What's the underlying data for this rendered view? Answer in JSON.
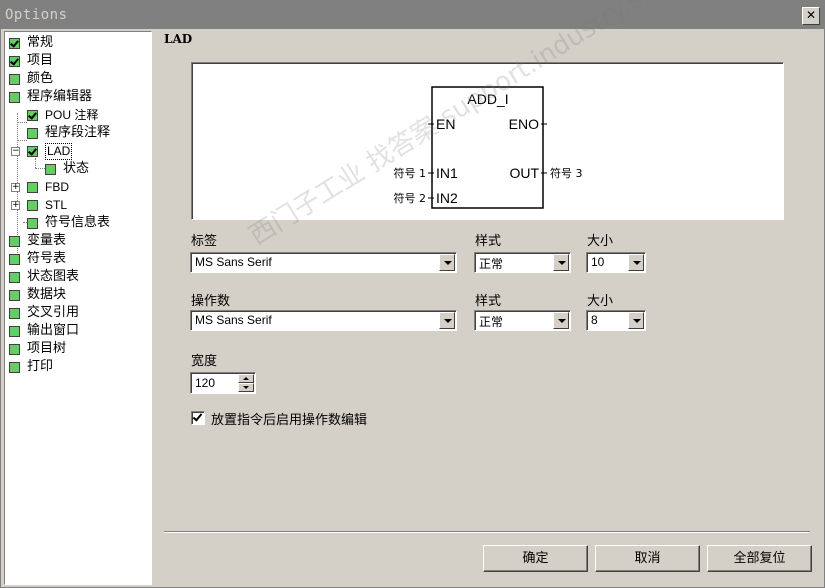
{
  "window": {
    "title": "Options",
    "close_glyph": "✕"
  },
  "tree": [
    {
      "label": "常规",
      "checked": true
    },
    {
      "label": "项目",
      "checked": true
    },
    {
      "label": "颜色",
      "checked": false
    },
    {
      "label": "程序编辑器",
      "checked": false
    },
    {
      "label": "POU 注释",
      "checked": true
    },
    {
      "label": "程序段注释",
      "checked": false
    },
    {
      "label": "LAD",
      "checked": true,
      "expander": "−"
    },
    {
      "label": "状态",
      "checked": false
    },
    {
      "label": "FBD",
      "checked": false,
      "expander": "+"
    },
    {
      "label": "STL",
      "checked": false,
      "expander": "+"
    },
    {
      "label": "符号信息表",
      "checked": false
    },
    {
      "label": "变量表",
      "checked": false
    },
    {
      "label": "符号表",
      "checked": false
    },
    {
      "label": "状态图表",
      "checked": false
    },
    {
      "label": "数据块",
      "checked": false
    },
    {
      "label": "交叉引用",
      "checked": false
    },
    {
      "label": "输出窗口",
      "checked": false
    },
    {
      "label": "项目树",
      "checked": false
    },
    {
      "label": "打印",
      "checked": false
    }
  ],
  "panel": {
    "title": "LAD",
    "preview": {
      "block_name": "ADD_I",
      "en": "EN",
      "eno": "ENO",
      "in1": "IN1",
      "in2": "IN2",
      "out": "OUT",
      "sym1": "符号 1",
      "sym2": "符号 2",
      "sym3": "符号 3"
    },
    "label_section": {
      "label": "标签",
      "font": "MS Sans Serif",
      "style_label": "样式",
      "style": "正常",
      "size_label": "大小",
      "size": "10"
    },
    "operand_section": {
      "label": "操作数",
      "font": "MS Sans Serif",
      "style_label": "样式",
      "style": "正常",
      "size_label": "大小",
      "size": "8"
    },
    "width": {
      "label": "宽度",
      "value": "120"
    },
    "enable_edit": {
      "label": "放置指令后启用操作数编辑",
      "checked": true
    }
  },
  "buttons": {
    "ok": "确定",
    "cancel": "取消",
    "reset_all": "全部复位"
  },
  "watermark": "西门子工业 找答案 support.industry.siemens.com/cs"
}
